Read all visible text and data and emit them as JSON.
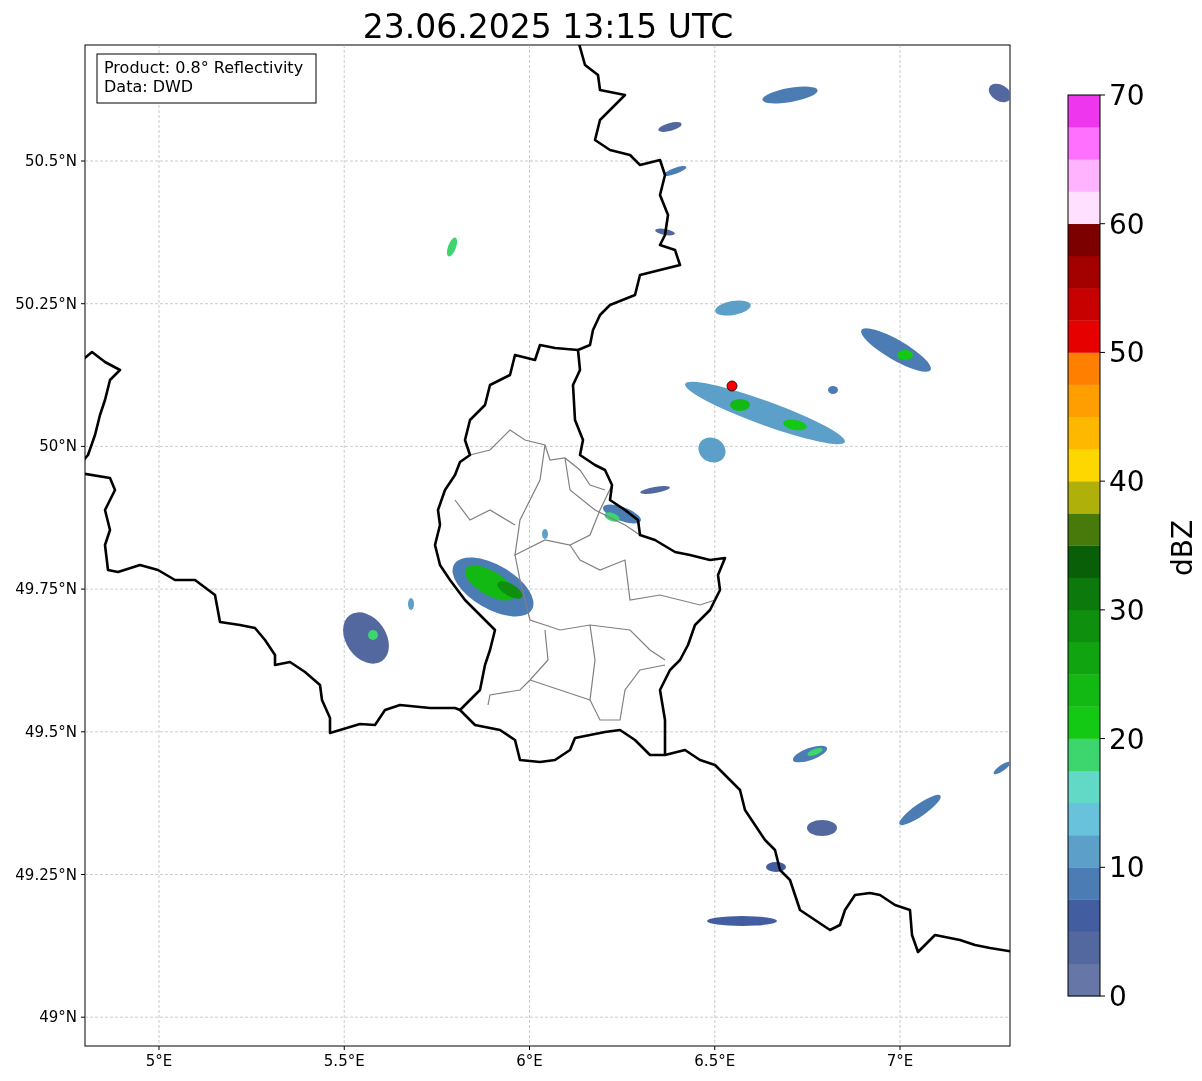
{
  "title": "23.06.2025 13:15 UTC",
  "map": {
    "info_box": [
      "Product: 0.8° Reflectivity",
      "Data: DWD"
    ],
    "lon_ticks": [
      "5°E",
      "5.5°E",
      "6°E",
      "6.5°E",
      "7°E"
    ],
    "lat_ticks": [
      "50.5°N",
      "50.25°N",
      "50°N",
      "49.75°N",
      "49.5°N",
      "49.25°N",
      "49°N"
    ]
  },
  "colorbar": {
    "label": "dBZ",
    "ticks": [
      "70",
      "60",
      "50",
      "40",
      "30",
      "20",
      "10",
      "0"
    ],
    "segments": [
      {
        "color": "#6676a6"
      },
      {
        "color": "#53689f"
      },
      {
        "color": "#425ea0"
      },
      {
        "color": "#4b7cb4"
      },
      {
        "color": "#5c9fc8"
      },
      {
        "color": "#68c2dc"
      },
      {
        "color": "#62d8c6"
      },
      {
        "color": "#3dd66e"
      },
      {
        "color": "#14c914"
      },
      {
        "color": "#12b912"
      },
      {
        "color": "#10a510"
      },
      {
        "color": "#0e8f0e"
      },
      {
        "color": "#0b790b"
      },
      {
        "color": "#085f08"
      },
      {
        "color": "#487a0b"
      },
      {
        "color": "#b0b00a"
      },
      {
        "color": "#ffd700"
      },
      {
        "color": "#ffb800"
      },
      {
        "color": "#ff9e00"
      },
      {
        "color": "#ff7f00"
      },
      {
        "color": "#e60000"
      },
      {
        "color": "#c70000"
      },
      {
        "color": "#a30000"
      },
      {
        "color": "#7d0000"
      },
      {
        "color": "#ffe0ff"
      },
      {
        "color": "#ffb3ff"
      },
      {
        "color": "#ff70ff"
      },
      {
        "color": "#ee36ee"
      }
    ]
  }
}
